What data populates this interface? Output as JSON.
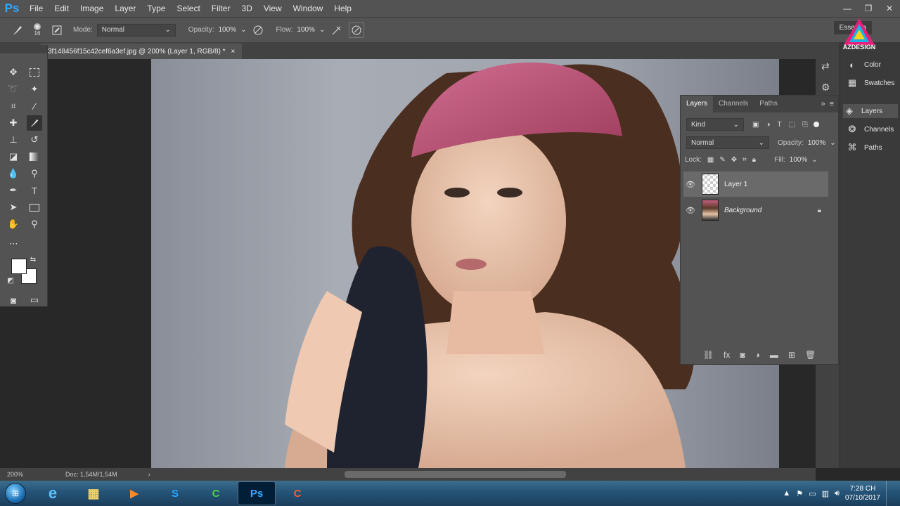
{
  "app": {
    "logo": "Ps"
  },
  "menu": [
    "File",
    "Edit",
    "Image",
    "Layer",
    "Type",
    "Select",
    "Filter",
    "3D",
    "View",
    "Window",
    "Help"
  ],
  "window_controls": {
    "minimize": "—",
    "restore": "❐",
    "close": "✕"
  },
  "options": {
    "brush_size": "16",
    "mode_label": "Mode:",
    "mode_value": "Normal",
    "opacity_label": "Opacity:",
    "opacity_value": "100%",
    "flow_label": "Flow:",
    "flow_value": "100%",
    "workspace": "Essentia"
  },
  "document": {
    "tab_title": "3f148456f15c42cef6a3ef.jpg @ 200% (Layer 1, RGB/8) *",
    "close": "×"
  },
  "status": {
    "zoom": "200%",
    "doc_size": "Doc: 1,54M/1,54M",
    "arrow": "›"
  },
  "dock": {
    "items": [
      {
        "label": "Color",
        "icon": "color-icon"
      },
      {
        "label": "Swatches",
        "icon": "swatches-icon"
      },
      {
        "label": "Layers",
        "icon": "layers-icon",
        "active": true
      },
      {
        "label": "Channels",
        "icon": "channels-icon"
      },
      {
        "label": "Paths",
        "icon": "paths-icon"
      }
    ]
  },
  "layers_panel": {
    "tabs": [
      "Layers",
      "Channels",
      "Paths"
    ],
    "active_tab": "Layers",
    "filter_kind": "Kind",
    "blend_mode": "Normal",
    "opacity_label": "Opacity:",
    "opacity_value": "100%",
    "lock_label": "Lock:",
    "fill_label": "Fill:",
    "fill_value": "100%",
    "layers": [
      {
        "name": "Layer 1",
        "selected": true,
        "visible": true,
        "locked": false
      },
      {
        "name": "Background",
        "selected": false,
        "visible": true,
        "locked": true
      }
    ]
  },
  "watermark": {
    "text": "AZDESIGN"
  },
  "taskbar": {
    "apps": [
      {
        "name": "internet-explorer",
        "glyph": "e"
      },
      {
        "name": "file-explorer",
        "glyph": "▦"
      },
      {
        "name": "media-player",
        "glyph": "▶"
      },
      {
        "name": "skype",
        "glyph": "S"
      },
      {
        "name": "camtasia",
        "glyph": "C"
      },
      {
        "name": "photoshop",
        "glyph": "Ps",
        "active": true
      },
      {
        "name": "camtasia-recorder",
        "glyph": "C"
      }
    ],
    "clock_time": "7:28 CH",
    "clock_date": "07/10/2017"
  },
  "colors": {
    "ps_blue": "#31a8ff",
    "panel": "#535353",
    "dark": "#424242"
  }
}
